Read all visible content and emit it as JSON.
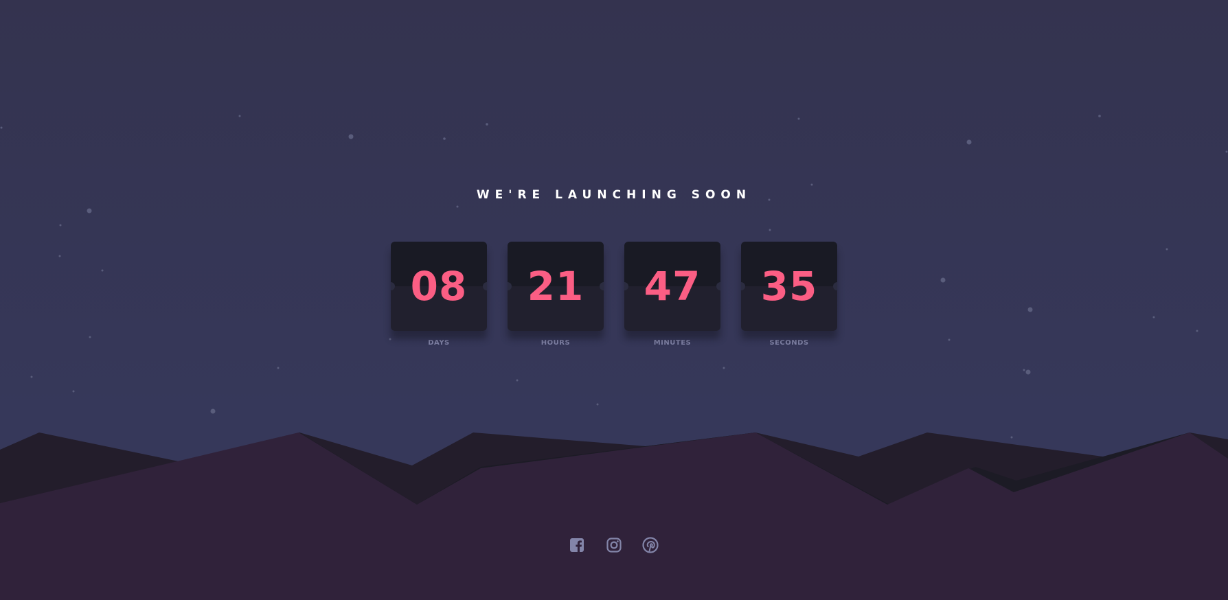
{
  "headline": "WE'RE LAUNCHING SOON",
  "countdown": [
    {
      "value": "08",
      "label": "DAYS"
    },
    {
      "value": "21",
      "label": "HOURS"
    },
    {
      "value": "47",
      "label": "MINUTES"
    },
    {
      "value": "35",
      "label": "SECONDS"
    }
  ],
  "social": {
    "icons": [
      "facebook-icon",
      "instagram-icon",
      "pinterest-icon"
    ]
  },
  "colors": {
    "background": "#343650",
    "accent": "#fb5e84",
    "label": "#8385a9",
    "card_top": "#191a24",
    "card_bottom": "#21202e",
    "hill_front": "#30223a",
    "hill_back": "#231d2b",
    "icon": "#8385a9"
  }
}
